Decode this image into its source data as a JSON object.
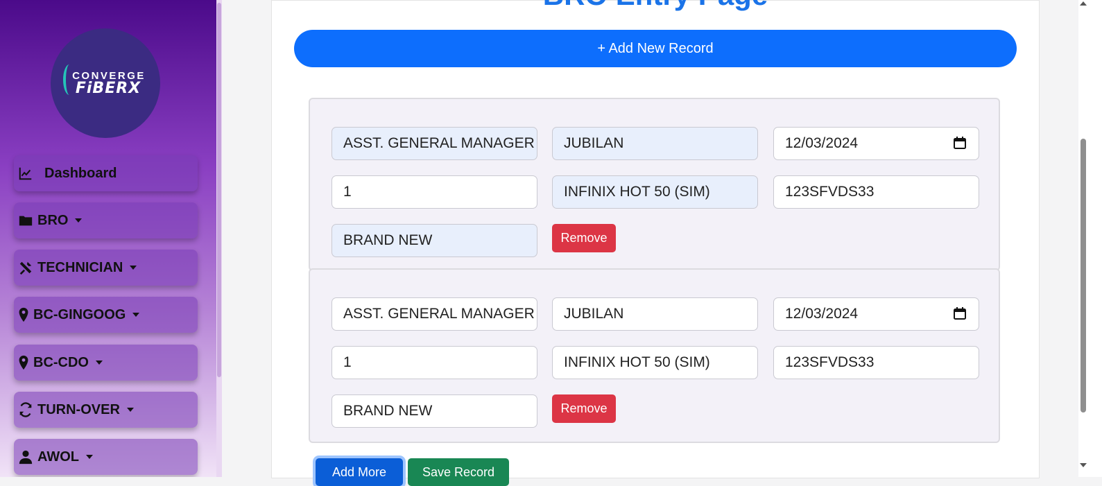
{
  "sidebar": {
    "logo": {
      "top_text": "CONVERGE",
      "bottom_text": "FiBERX"
    },
    "items": [
      {
        "label": "Dashboard",
        "icon": "chart-line-icon",
        "has_caret": false
      },
      {
        "label": "BRO",
        "icon": "folder-icon",
        "has_caret": true
      },
      {
        "label": "TECHNICIAN",
        "icon": "tools-icon",
        "has_caret": true
      },
      {
        "label": "BC-GINGOOG",
        "icon": "map-pin-icon",
        "has_caret": true
      },
      {
        "label": "BC-CDO",
        "icon": "map-pin-icon",
        "has_caret": true
      },
      {
        "label": "TURN-OVER",
        "icon": "sync-icon",
        "has_caret": true
      },
      {
        "label": "AWOL",
        "icon": "user-icon",
        "has_caret": true
      }
    ]
  },
  "main": {
    "title": "BRO Entry Page",
    "add_record_label": "+ Add New Record",
    "records": [
      {
        "position": "ASST. GENERAL MANAGER",
        "name": "JUBILAN",
        "date": "12/03/2024",
        "quantity": "1",
        "item": "INFINIX HOT 50 (SIM)",
        "serial": "123SFVDS33",
        "condition": "BRAND NEW",
        "remove_label": "Remove"
      },
      {
        "position": "ASST. GENERAL MANAGER",
        "name": "JUBILAN",
        "date": "12/03/2024",
        "quantity": "1",
        "item": "INFINIX HOT 50 (SIM)",
        "serial": "123SFVDS33",
        "condition": "BRAND NEW",
        "remove_label": "Remove"
      }
    ],
    "add_more_label": "Add More",
    "save_label": "Save Record"
  },
  "colors": {
    "primary": "#0d6efd",
    "danger": "#dc3545",
    "success": "#198754",
    "sidebar_top": "#4b0a8a",
    "title_blue": "#1a73e8"
  }
}
